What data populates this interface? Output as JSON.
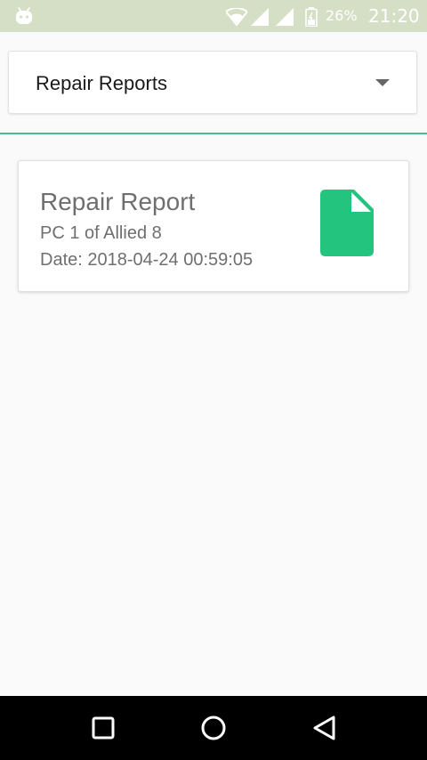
{
  "status_bar": {
    "battery_percent": "26%",
    "time": "21:20",
    "icons": [
      "android-icon",
      "wifi-icon",
      "signal-icon",
      "signal-icon",
      "battery-icon"
    ]
  },
  "spinner": {
    "selected_value": "Repair Reports"
  },
  "report_card": {
    "title": "Repair Report",
    "subtitle": "PC 1 of Allied 8",
    "date": "Date: 2018-04-24 00:59:05",
    "icon": "document-icon"
  },
  "nav_bar": {
    "buttons": [
      "recents",
      "home",
      "back"
    ]
  },
  "colors": {
    "status_bar_bg": "#d4dfc6",
    "accent": "#4cbb8a",
    "document_icon": "#22c47e",
    "card_text": "#6f6f6f",
    "nav_bar_bg": "#000000"
  }
}
